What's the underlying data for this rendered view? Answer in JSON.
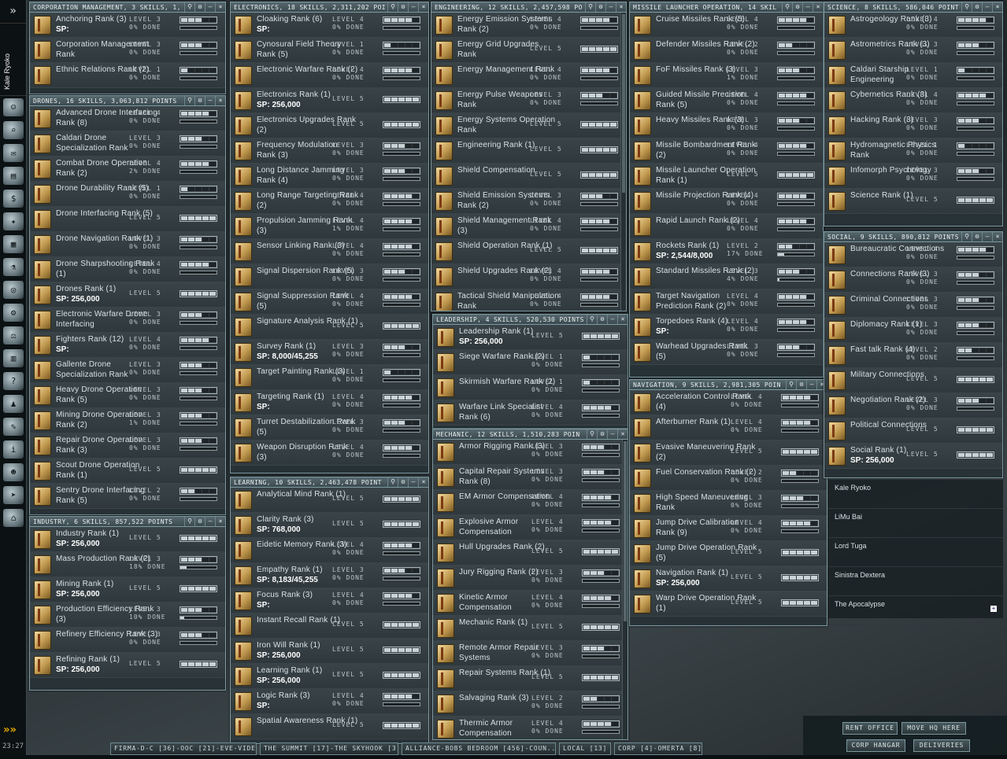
{
  "neocom": {
    "expand": "»",
    "character": "Kale Ryoko",
    "clock": "23:27",
    "arrows": "»»",
    "buttons": [
      "character-sheet-icon",
      "search-icon",
      "mail-icon",
      "notepad-icon",
      "market-icon",
      "map-icon",
      "assets-icon",
      "science-icon",
      "overview-icon",
      "fitting-icon",
      "skills-icon",
      "calculator-icon",
      "help-icon",
      "people-icon",
      "contracts-icon",
      "info-icon",
      "avatar-icon",
      "ship-icon",
      "station-icon"
    ]
  },
  "windows": [
    {
      "id": "corp",
      "title": "CORPORATION MANAGEMENT, 3 SKILLS, 1,",
      "scroll": false,
      "skills": [
        {
          "name": "Anchoring Rank (3)",
          "sp": "SP:",
          "level": 3,
          "done": "0% DONE"
        },
        {
          "name": "Corporation Management Rank",
          "level": 3,
          "done": "0% DONE"
        },
        {
          "name": "Ethnic Relations Rank (2)",
          "level": 1,
          "done": "0% DONE"
        }
      ]
    },
    {
      "id": "drones",
      "title": "DRONES, 16 SKILLS, 3,063,812 POINTS",
      "scroll": false,
      "skills": [
        {
          "name": "Advanced Drone Interfacing Rank (8)",
          "level": 4,
          "done": "0% DONE"
        },
        {
          "name": "Caldari Drone Specialization Rank",
          "level": 3,
          "done": "0% DONE"
        },
        {
          "name": "Combat Drone Operation Rank (2)",
          "level": 4,
          "done": "2% DONE"
        },
        {
          "name": "Drone Durability Rank (5)",
          "level": 1,
          "done": "0% DONE"
        },
        {
          "name": "Drone Interfacing Rank (5)",
          "level": 5
        },
        {
          "name": "Drone Navigation Rank (1)",
          "level": 3,
          "done": "0% DONE"
        },
        {
          "name": "Drone Sharpshooting Rank (1)",
          "level": 4,
          "done": "0% DONE"
        },
        {
          "name": "Drones Rank (1)",
          "sp": "SP: 256,000",
          "level": 5
        },
        {
          "name": "Electronic Warfare Drone Interfacing",
          "level": 3,
          "done": "0% DONE"
        },
        {
          "name": "Fighters Rank (12)",
          "sp": "SP:",
          "level": 4,
          "done": "0% DONE"
        },
        {
          "name": "Gallente Drone Specialization Rank",
          "level": 3,
          "done": "0% DONE"
        },
        {
          "name": "Heavy Drone Operation Rank (5)",
          "level": 3,
          "done": "0% DONE"
        },
        {
          "name": "Mining Drone Operation Rank (2)",
          "level": 3,
          "done": "1% DONE"
        },
        {
          "name": "Repair Drone Operation Rank (3)",
          "level": 3,
          "done": "0% DONE"
        },
        {
          "name": "Scout Drone Operation Rank (1)",
          "level": 5
        },
        {
          "name": "Sentry Drone Interfacing Rank (5)",
          "level": 2,
          "done": "0% DONE"
        }
      ]
    },
    {
      "id": "industry",
      "title": "INDUSTRY, 6 SKILLS, 857,522 POINTS",
      "scroll": false,
      "skills": [
        {
          "name": "Industry Rank (1)",
          "sp": "SP: 256,000",
          "level": 5
        },
        {
          "name": "Mass Production Rank (2)",
          "level": 3,
          "done": "18% DONE",
          "progress": 0.18
        },
        {
          "name": "Mining Rank (1)",
          "sp": "SP: 256,000",
          "level": 5
        },
        {
          "name": "Production Efficiency Rank (3)",
          "level": 3,
          "done": "10% DONE",
          "progress": 0.1
        },
        {
          "name": "Refinery Efficiency Rank (3)",
          "level": 3,
          "done": "0% DONE"
        },
        {
          "name": "Refining Rank (1)",
          "sp": "SP: 256,000",
          "level": 5
        }
      ]
    },
    {
      "id": "electronics",
      "title": "ELECTRONICS, 18 SKILLS, 2,311,202 POI",
      "scroll": false,
      "skills": [
        {
          "name": "Cloaking Rank (6)",
          "sp": "SP:",
          "level": 4,
          "done": "0% DONE"
        },
        {
          "name": "Cynosural Field Theory Rank (5)",
          "level": 1,
          "done": "0% DONE"
        },
        {
          "name": "Electronic Warfare Rank (2)",
          "level": 4,
          "done": "0% DONE"
        },
        {
          "name": "Electronics Rank (1)",
          "sp": "SP: 256,000",
          "level": 5
        },
        {
          "name": "Electronics Upgrades Rank (2)",
          "level": 5
        },
        {
          "name": "Frequency Modulation Rank (3)",
          "level": 3,
          "done": "0% DONE"
        },
        {
          "name": "Long Distance Jamming Rank (4)",
          "level": 3,
          "done": "0% DONE"
        },
        {
          "name": "Long Range Targeting Rank (2)",
          "level": 4,
          "done": "0% DONE"
        },
        {
          "name": "Propulsion Jamming Rank (3)",
          "level": 4,
          "done": "1% DONE"
        },
        {
          "name": "Sensor Linking Rank (3)",
          "level": 4,
          "done": "0% DONE"
        },
        {
          "name": "Signal Dispersion Rank (5)",
          "level": 3,
          "done": "0% DONE"
        },
        {
          "name": "Signal Suppression Rank (5)",
          "level": 4,
          "done": "0% DONE"
        },
        {
          "name": "Signature Analysis Rank (1)",
          "level": 5
        },
        {
          "name": "Survey Rank (1)",
          "sp": "SP: 8,000/45,255",
          "level": 3,
          "done": "0% DONE"
        },
        {
          "name": "Target Painting Rank (3)",
          "level": 1,
          "done": "0% DONE"
        },
        {
          "name": "Targeting Rank (1)",
          "sp": "SP:",
          "level": 4,
          "done": "0% DONE"
        },
        {
          "name": "Turret Destabilization Rank (5)",
          "level": 3,
          "done": "0% DONE"
        },
        {
          "name": "Weapon Disruption Rank (3)",
          "level": 4,
          "done": "0% DONE"
        }
      ]
    },
    {
      "id": "learning",
      "title": "LEARNING, 10 SKILLS, 2,463,478 POINT",
      "scroll": false,
      "skills": [
        {
          "name": "Analytical Mind Rank (1)",
          "level": 5
        },
        {
          "name": "Clarity Rank (3)",
          "sp": "SP: 768,000",
          "level": 5
        },
        {
          "name": "Eidetic Memory Rank (3)",
          "level": 4,
          "done": "0% DONE"
        },
        {
          "name": "Empathy Rank (1)",
          "sp": "SP: 8,183/45,255",
          "level": 3,
          "done": "0% DONE"
        },
        {
          "name": "Focus Rank (3)",
          "sp": "SP:",
          "level": 4,
          "done": "0% DONE"
        },
        {
          "name": "Instant Recall Rank (1)",
          "level": 5
        },
        {
          "name": "Iron Will Rank (1)",
          "sp": "SP: 256,000",
          "level": 5
        },
        {
          "name": "Learning Rank (1)",
          "sp": "SP: 256,000",
          "level": 5
        },
        {
          "name": "Logic Rank (3)",
          "sp": "SP:",
          "level": 4,
          "done": "0% DONE"
        },
        {
          "name": "Spatial Awareness Rank (1)",
          "level": 5
        }
      ]
    },
    {
      "id": "engineering",
      "title": "ENGINEERING, 12 SKILLS, 2,457,598 PO",
      "scroll": true,
      "skills": [
        {
          "name": "Energy Emission Systems Rank (2)",
          "level": 4,
          "done": "0% DONE"
        },
        {
          "name": "Energy Grid Upgrades Rank",
          "level": 5
        },
        {
          "name": "Energy Management Rank",
          "level": 4,
          "done": "0% DONE"
        },
        {
          "name": "Energy Pulse Weapons Rank",
          "level": 3,
          "done": "0% DONE"
        },
        {
          "name": "Energy Systems Operation Rank",
          "level": 5
        },
        {
          "name": "Engineering Rank (1)",
          "level": 5
        },
        {
          "name": "Shield Compensation",
          "level": 5
        },
        {
          "name": "Shield Emission Systems Rank (2)",
          "level": 3,
          "done": "0% DONE"
        },
        {
          "name": "Shield Management Rank (3)",
          "level": 4,
          "done": "0% DONE"
        },
        {
          "name": "Shield Operation Rank (1)",
          "level": 5
        },
        {
          "name": "Shield Upgrades Rank (2)",
          "level": 4,
          "done": "0% DONE"
        },
        {
          "name": "Tactical Shield Manipulation Rank",
          "level": 4,
          "done": "0% DONE"
        }
      ]
    },
    {
      "id": "leadership",
      "title": "LEADERSHIP, 4 SKILLS, 520,530 POINTS",
      "scroll": false,
      "skills": [
        {
          "name": "Leadership Rank (1)",
          "sp": "SP: 256,000",
          "level": 5
        },
        {
          "name": "Siege Warfare Rank (2)",
          "level": 1,
          "done": "0% DONE"
        },
        {
          "name": "Skirmish Warfare Rank (2)",
          "level": 1,
          "done": "0% DONE"
        },
        {
          "name": "Warfare Link Specialist Rank (6)",
          "level": 4,
          "done": "0% DONE"
        }
      ]
    },
    {
      "id": "mechanic",
      "title": "MECHANIC, 12 SKILLS, 1,510,283 POIN",
      "scroll": true,
      "skills": [
        {
          "name": "Armor Rigging Rank (3)",
          "level": 3,
          "done": "0% DONE"
        },
        {
          "name": "Capital Repair Systems Rank (8)",
          "level": 3,
          "done": "0% DONE"
        },
        {
          "name": "EM Armor Compensation",
          "level": 4,
          "done": "0% DONE"
        },
        {
          "name": "Explosive Armor Compensation",
          "level": 4,
          "done": "0% DONE"
        },
        {
          "name": "Hull Upgrades Rank (2)",
          "level": 5
        },
        {
          "name": "Jury Rigging Rank (2)",
          "level": 3,
          "done": "0% DONE"
        },
        {
          "name": "Kinetic Armor Compensation",
          "level": 4,
          "done": "0% DONE"
        },
        {
          "name": "Mechanic Rank (1)",
          "level": 5
        },
        {
          "name": "Remote Armor Repair Systems",
          "level": 3,
          "done": "0% DONE"
        },
        {
          "name": "Repair Systems Rank (1)",
          "level": 5
        },
        {
          "name": "Salvaging Rank (3)",
          "level": 2,
          "done": "0% DONE"
        },
        {
          "name": "Thermic Armor Compensation",
          "level": 4,
          "done": "0% DONE"
        }
      ]
    },
    {
      "id": "missile",
      "title": "MISSILE LAUNCHER OPERATION, 14 SKIL",
      "scroll": false,
      "skills": [
        {
          "name": "Cruise Missiles Rank (5)",
          "level": 4,
          "done": "0% DONE"
        },
        {
          "name": "Defender Missiles Rank (2)",
          "level": 2,
          "done": "0% DONE"
        },
        {
          "name": "FoF Missiles Rank (3)",
          "level": 3,
          "done": "1% DONE"
        },
        {
          "name": "Guided Missile Precision Rank (5)",
          "level": 4,
          "done": "0% DONE"
        },
        {
          "name": "Heavy Missiles Rank (3)",
          "level": 3,
          "done": "0% DONE"
        },
        {
          "name": "Missile Bombardment Rank (2)",
          "level": 4,
          "done": "0% DONE"
        },
        {
          "name": "Missile Launcher Operation Rank (1)",
          "level": 5
        },
        {
          "name": "Missile Projection Rank (4)",
          "level": 4,
          "done": "0% DONE"
        },
        {
          "name": "Rapid Launch Rank (2)",
          "level": 4,
          "done": "0% DONE"
        },
        {
          "name": "Rockets Rank (1)",
          "sp": "SP: 2,544/8,000",
          "level": 2,
          "done": "17% DONE",
          "progress": 0.17
        },
        {
          "name": "Standard Missiles Rank (2)",
          "level": 3,
          "done": "4% DONE",
          "progress": 0.04
        },
        {
          "name": "Target Navigation Prediction Rank (2)",
          "level": 4,
          "done": "0% DONE"
        },
        {
          "name": "Torpedoes Rank (4)",
          "sp": "SP:",
          "level": 4,
          "done": "0% DONE"
        },
        {
          "name": "Warhead Upgrades Rank (5)",
          "level": 3,
          "done": "0% DONE"
        }
      ]
    },
    {
      "id": "navigation",
      "title": "NAVIGATION, 9 SKILLS, 2,981,305 POIN",
      "scroll": false,
      "skills": [
        {
          "name": "Acceleration Control Rank (4)",
          "level": 4,
          "done": "0% DONE"
        },
        {
          "name": "Afterburner Rank (1)",
          "level": 4,
          "done": "0% DONE"
        },
        {
          "name": "Evasive Maneuvering Rank (2)",
          "level": 5
        },
        {
          "name": "Fuel Conservation Rank (2)",
          "level": 2,
          "done": "0% DONE"
        },
        {
          "name": "High Speed Maneuvering Rank",
          "level": 3,
          "done": "0% DONE"
        },
        {
          "name": "Jump Drive Calibration Rank (9)",
          "level": 4,
          "done": "0% DONE"
        },
        {
          "name": "Jump Drive Operation Rank (5)",
          "level": 5
        },
        {
          "name": "Navigation Rank (1)",
          "sp": "SP: 256,000",
          "level": 5
        },
        {
          "name": "Warp Drive Operation Rank (1)",
          "level": 5
        }
      ]
    },
    {
      "id": "science",
      "title": "SCIENCE, 8 SKILLS, 586,046 POINT",
      "scroll": false,
      "skills": [
        {
          "name": "Astrogeology Rank (3)",
          "level": 4,
          "done": "0% DONE"
        },
        {
          "name": "Astrometrics Rank (3)",
          "level": 3,
          "done": "0% DONE"
        },
        {
          "name": "Caldari Starship Engineering",
          "level": 1,
          "done": "0% DONE"
        },
        {
          "name": "Cybernetics Rank (3)",
          "level": 4,
          "done": "0% DONE"
        },
        {
          "name": "Hacking Rank (3)",
          "level": 3,
          "done": "0% DONE"
        },
        {
          "name": "Hydromagnetic Physics Rank",
          "level": 1,
          "done": "0% DONE"
        },
        {
          "name": "Infomorph Psychology",
          "level": 3,
          "done": "0% DONE"
        },
        {
          "name": "Science Rank (1)",
          "level": 5
        }
      ]
    },
    {
      "id": "social",
      "title": "SOCIAL, 9 SKILLS, 890,812 POINTS",
      "scroll": false,
      "skills": [
        {
          "name": "Bureaucratic Connections",
          "level": 4,
          "done": "0% DONE"
        },
        {
          "name": "Connections Rank (3)",
          "level": 3,
          "done": "0% DONE"
        },
        {
          "name": "Criminal Connections",
          "level": 3,
          "done": "0% DONE"
        },
        {
          "name": "Diplomacy Rank (1)",
          "level": 3,
          "done": "0% DONE"
        },
        {
          "name": "Fast talk Rank (4)",
          "level": 2,
          "done": "0% DONE"
        },
        {
          "name": "Military Connections",
          "level": 5
        },
        {
          "name": "Negotiation Rank (2)",
          "level": 3,
          "done": "0% DONE"
        },
        {
          "name": "Political Connections",
          "level": 5
        },
        {
          "name": "Social Rank (1)",
          "sp": "SP: 256,000",
          "level": 5
        }
      ]
    }
  ],
  "members": [
    "Kale Ryoko",
    "LiMu Bai",
    "Lord Tuga",
    "Sinistra Dextera",
    "The Apocalypse"
  ],
  "corp_buttons": {
    "rent": "RENT OFFICE",
    "move": "MOVE HQ HERE",
    "hangar": "CORP HANGAR",
    "deliveries": "DELIVERIES"
  },
  "taskbar": [
    "FIRMA-D-C [36]-OOC [21]-EVE-VIDE...",
    "THE SUMMIT [17]-THE SKYHOOK [3]",
    "ALLIANCE-BOBS BEDROOM [456]-COUN...",
    "LOCAL [13]",
    "CORP [4]-OMERTA [8]"
  ],
  "level_prefix": "LEVEL"
}
